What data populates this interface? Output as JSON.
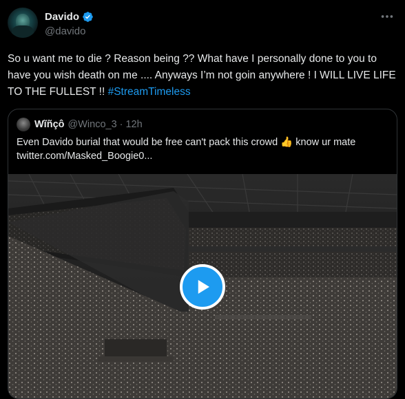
{
  "author": {
    "name": "Davido",
    "handle": "@davido",
    "verified": true
  },
  "tweet": {
    "text": "So u want me to die ? Reason being ?? What have I personally done to you to have you wish death on me .... Anyways I’m not goin anywhere ! I WILL LIVE LIFE TO THE FULLEST !! ",
    "hashtag": "#StreamTimeless"
  },
  "quoted_tweet": {
    "name": "Wĩñçô",
    "handle": "@Winco_3",
    "separator": "·",
    "time": "12h",
    "text": "Even Davido burial that would be free can't pack this crowd 👍 know ur mate twitter.com/Masked_Boogie0..."
  },
  "media": {
    "type": "video",
    "play_icon": "play-icon"
  },
  "colors": {
    "background": "#000000",
    "text": "#e7e9ea",
    "secondary": "#71767b",
    "accent": "#1d9bf0",
    "border": "#2f3336"
  },
  "icons": [
    "verified-badge-icon",
    "more-options-icon",
    "play-icon"
  ]
}
